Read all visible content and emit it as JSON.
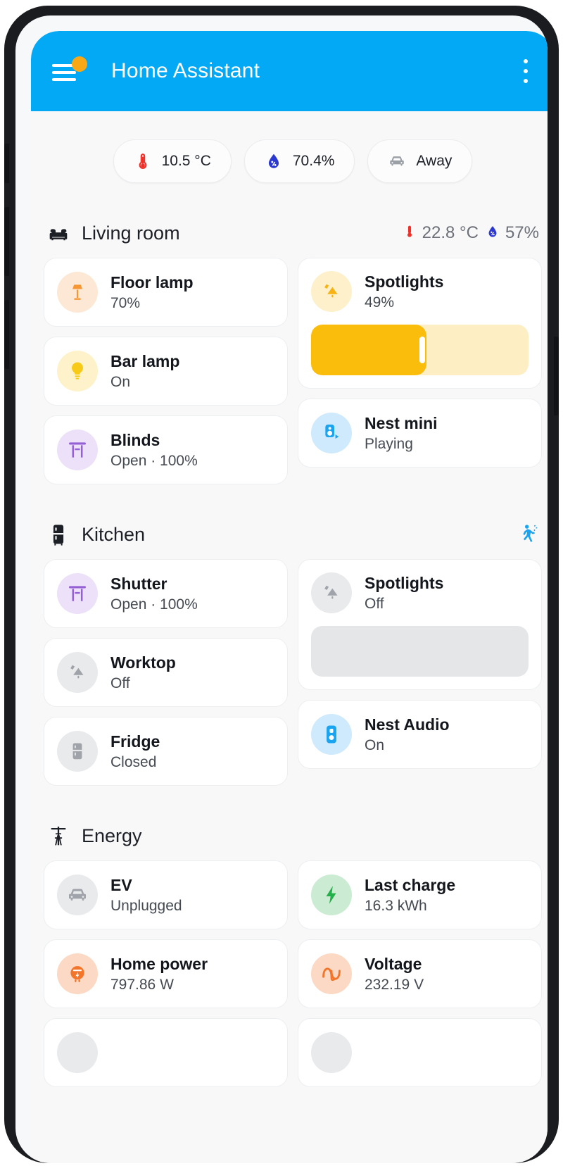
{
  "app": {
    "title": "Home Assistant",
    "menu_icon": "hamburger-menu-icon",
    "menu_badge": "notification-dot",
    "overflow_icon": "overflow-menu-icon",
    "header_color": "#03a9f4",
    "badge_color": "#f8a814",
    "surface_color": "#f8f8f9"
  },
  "chips": [
    {
      "icon": "thermometer-icon",
      "label": "10.5 °C",
      "color": "#ef2f28"
    },
    {
      "icon": "humidity-icon",
      "label": "70.4%",
      "color": "#2c39d0"
    },
    {
      "icon": "car-icon",
      "label": "Away",
      "color": "#9aa0a6"
    }
  ],
  "sections": [
    {
      "title": "Living room",
      "icon": "sofa-icon",
      "badges": [
        {
          "icon": "thermometer-icon",
          "label": "22.8 °C",
          "color": "#ef2f28"
        },
        {
          "icon": "humidity-icon",
          "label": "57%",
          "color": "#2c39d0"
        }
      ],
      "left": [
        {
          "name": "Floor lamp",
          "state": "70%",
          "icon": "floor-lamp-icon",
          "icon_color": "#f79733",
          "bg_color": "#fde8d5"
        },
        {
          "name": "Bar lamp",
          "state": "On",
          "icon": "bulb-icon",
          "icon_color": "#f7ca18",
          "bg_color": "#fdf2c9"
        },
        {
          "name": "Blinds",
          "state": "Open · 100%",
          "icon": "blinds-icon",
          "icon_color": "#9560d4",
          "bg_color": "#ece1f9"
        }
      ],
      "right": [
        {
          "name": "Spotlights",
          "state": "49%",
          "icon": "spotlight-icon",
          "icon_color": "#f7b314",
          "bg_color": "#fdf0cb",
          "slider": {
            "value": 49,
            "fill_color": "#fbbd0b",
            "track_color": "#fdeec4"
          }
        },
        {
          "name": "Nest mini",
          "state": "Playing",
          "icon": "speaker-play-icon",
          "icon_color": "#1aa3ef",
          "bg_color": "#cfeafc"
        }
      ]
    },
    {
      "title": "Kitchen",
      "icon": "fridge-icon",
      "motion_icon": "motion-detected-icon",
      "motion_color": "#1aa3ef",
      "badges": [],
      "left": [
        {
          "name": "Shutter",
          "state": "Open · 100%",
          "icon": "blinds-icon",
          "icon_color": "#9560d4",
          "bg_color": "#ece1f9"
        },
        {
          "name": "Worktop",
          "state": "Off",
          "icon": "spotlight-icon",
          "icon_color": "#a0a4aa",
          "bg_color": "#e9eaec"
        },
        {
          "name": "Fridge",
          "state": "Closed",
          "icon": "fridge-icon",
          "icon_color": "#a0a4aa",
          "bg_color": "#e9eaec"
        }
      ],
      "right": [
        {
          "name": "Spotlights",
          "state": "Off",
          "icon": "spotlight-icon",
          "icon_color": "#a0a4aa",
          "bg_color": "#e9eaec",
          "slider": {
            "value": 0,
            "fill_color": "#e4e6e8",
            "track_color": "#e4e6e8"
          }
        },
        {
          "name": "Nest Audio",
          "state": "On",
          "icon": "speaker-icon",
          "icon_color": "#1aa3ef",
          "bg_color": "#cfeafc"
        }
      ]
    },
    {
      "title": "Energy",
      "icon": "transmission-tower-icon",
      "badges": [],
      "left": [
        {
          "name": "EV",
          "state": "Unplugged",
          "icon": "car-icon",
          "icon_color": "#a0a4aa",
          "bg_color": "#e9eaec"
        },
        {
          "name": "Home power",
          "state": "797.86 W",
          "icon": "meter-icon",
          "icon_color": "#ffffff",
          "bg_color": "#f2752a"
        }
      ],
      "right": [
        {
          "name": "Last charge",
          "state": "16.3 kWh",
          "icon": "lightning-icon",
          "icon_color": "#23b04a",
          "bg_color": "#cbecd3"
        },
        {
          "name": "Voltage",
          "state": "232.19 V",
          "icon": "sine-wave-icon",
          "icon_color": "#f2752a",
          "bg_color": "#fbd9c4"
        }
      ]
    }
  ]
}
